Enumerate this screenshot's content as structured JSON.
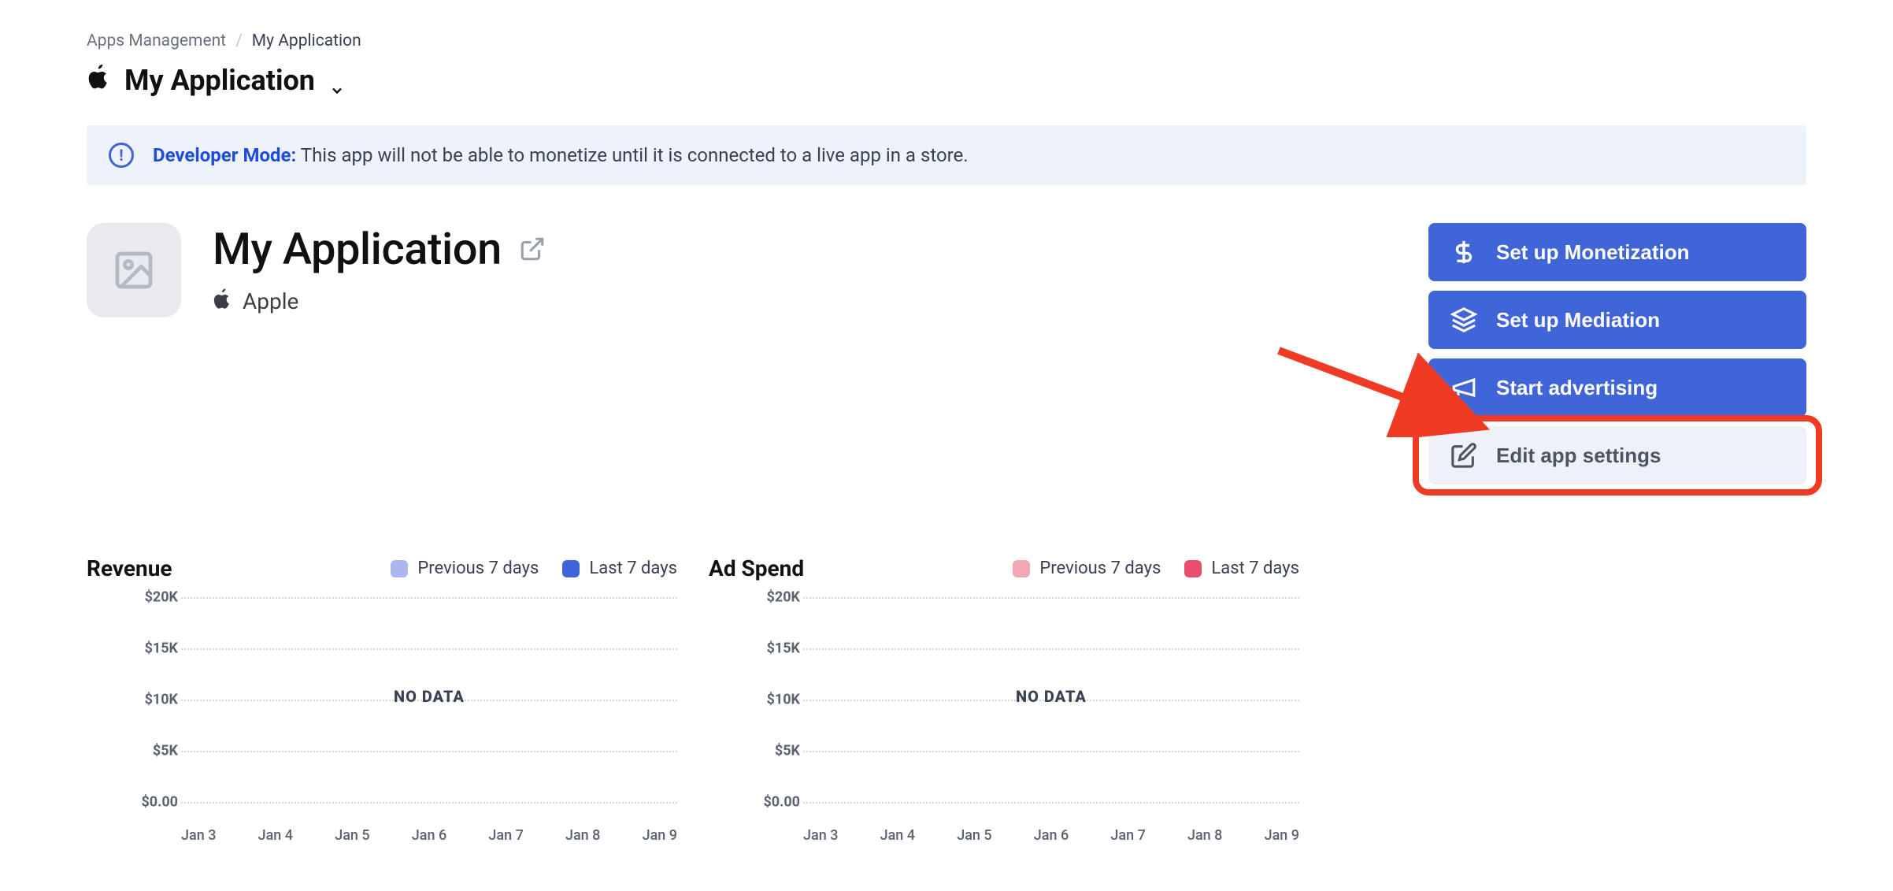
{
  "breadcrumb": {
    "parent": "Apps Management",
    "current": "My Application"
  },
  "page_heading": "My Application",
  "alert": {
    "strong": "Developer Mode:",
    "message": "This app will not be able to monetize until it is connected to a live app in a store."
  },
  "app": {
    "name": "My Application",
    "platform": "Apple"
  },
  "actions": {
    "monetization": "Set up Monetization",
    "mediation": "Set up Mediation",
    "advertising": "Start advertising",
    "edit_settings": "Edit app settings"
  },
  "charts": {
    "revenue": {
      "title": "Revenue",
      "legend_prev": "Previous 7 days",
      "legend_last": "Last 7 days",
      "prev_color": "#aab8ef",
      "last_color": "#4065d8"
    },
    "adspend": {
      "title": "Ad Spend",
      "legend_prev": "Previous 7 days",
      "legend_last": "Last 7 days",
      "prev_color": "#f2a8b4",
      "last_color": "#e84e6b"
    },
    "no_data": "NO DATA"
  },
  "chart_data": [
    {
      "type": "line",
      "title": "Revenue",
      "categories": [
        "Jan 3",
        "Jan 4",
        "Jan 5",
        "Jan 6",
        "Jan 7",
        "Jan 8",
        "Jan 9"
      ],
      "series": [
        {
          "name": "Previous 7 days",
          "values": [
            null,
            null,
            null,
            null,
            null,
            null,
            null
          ]
        },
        {
          "name": "Last 7 days",
          "values": [
            null,
            null,
            null,
            null,
            null,
            null,
            null
          ]
        }
      ],
      "ylabels": [
        "$20K",
        "$15K",
        "$10K",
        "$5K",
        "$0.00"
      ],
      "ylim": [
        0,
        20000
      ],
      "xlabel": "",
      "ylabel": "",
      "status": "NO DATA"
    },
    {
      "type": "line",
      "title": "Ad Spend",
      "categories": [
        "Jan 3",
        "Jan 4",
        "Jan 5",
        "Jan 6",
        "Jan 7",
        "Jan 8",
        "Jan 9"
      ],
      "series": [
        {
          "name": "Previous 7 days",
          "values": [
            null,
            null,
            null,
            null,
            null,
            null,
            null
          ]
        },
        {
          "name": "Last 7 days",
          "values": [
            null,
            null,
            null,
            null,
            null,
            null,
            null
          ]
        }
      ],
      "ylabels": [
        "$20K",
        "$15K",
        "$10K",
        "$5K",
        "$0.00"
      ],
      "ylim": [
        0,
        20000
      ],
      "xlabel": "",
      "ylabel": "",
      "status": "NO DATA"
    }
  ]
}
